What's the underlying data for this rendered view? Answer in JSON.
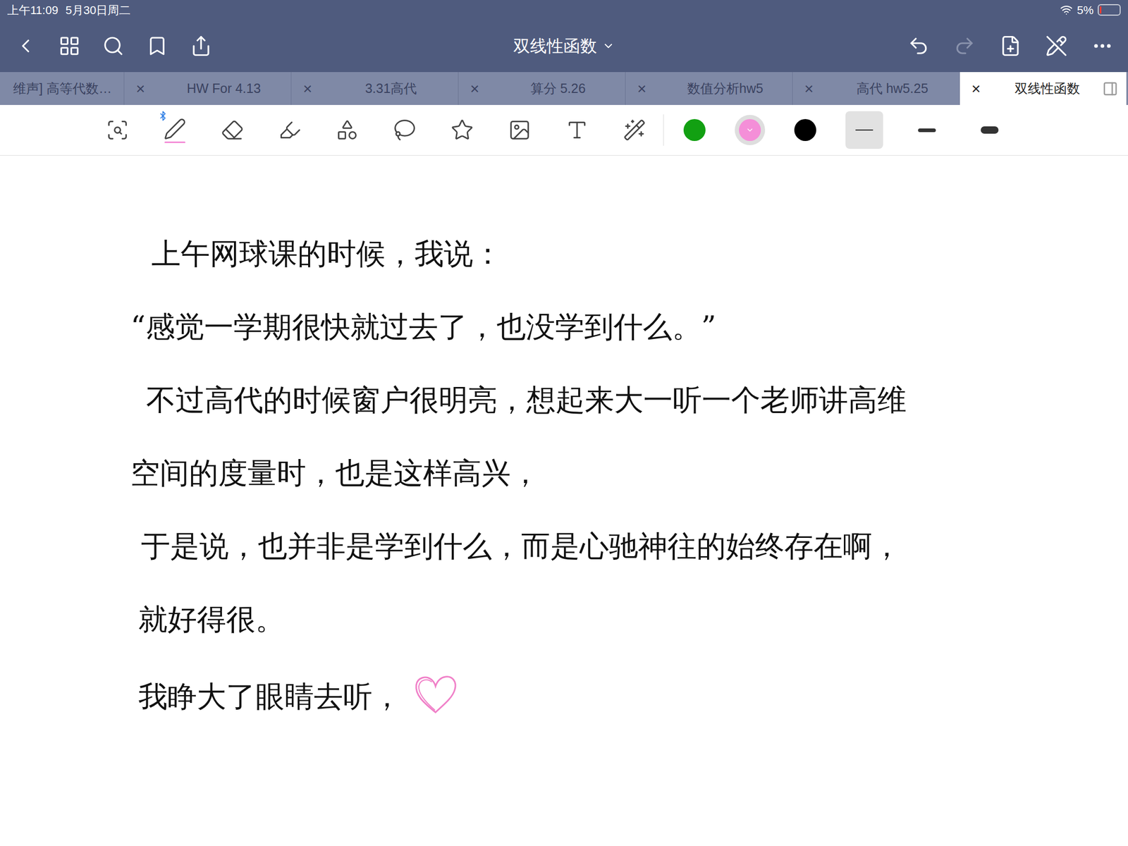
{
  "status_bar": {
    "time": "上午11:09",
    "date": "5月30日周二",
    "battery": "5%",
    "battery_level": 0.05
  },
  "window": {
    "title": "双线性函数",
    "redo_disabled": true
  },
  "tabs": [
    {
      "label": "维声] 高等代数…",
      "close": "",
      "selected": false
    },
    {
      "label": "HW For 4.13",
      "close": "×",
      "selected": false
    },
    {
      "label": "3.31高代",
      "close": "×",
      "selected": false
    },
    {
      "label": "算分 5.26",
      "close": "×",
      "selected": false
    },
    {
      "label": "数值分析hw5",
      "close": "×",
      "selected": false
    },
    {
      "label": "高代 hw5.25",
      "close": "×",
      "selected": false
    },
    {
      "label": "双线性函数",
      "close": "×",
      "selected": true
    }
  ],
  "tools": [
    {
      "selected": false
    },
    {
      "selected": true,
      "bluetooth": true
    },
    {
      "selected": false
    },
    {
      "selected": false
    },
    {
      "selected": false
    },
    {
      "selected": false
    },
    {
      "selected": false
    },
    {
      "selected": false
    },
    {
      "selected": false
    },
    {
      "selected": false
    }
  ],
  "colors": [
    {
      "color": "#12a012",
      "selected": false
    },
    {
      "color": "#f48fd8",
      "selected": true
    },
    {
      "color": "#000000",
      "selected": false
    }
  ],
  "stroke_widths": [
    {
      "selected": true
    },
    {
      "selected": false
    },
    {
      "selected": false
    }
  ],
  "note": {
    "lines": [
      "上午网球课的时候，我说：",
      "“感觉一学期很快就过去了，也没学到什么。”",
      "不过高代的时候窗户很明亮，想起来大一听一个老师讲高维",
      "空间的度量时，也是这样高兴，",
      "于是说，也并非是学到什么，而是心驰神往的始终存在啊，",
      "就好得很。",
      "我睁大了眼睛去听，"
    ],
    "heart_color": "#f080c8"
  }
}
